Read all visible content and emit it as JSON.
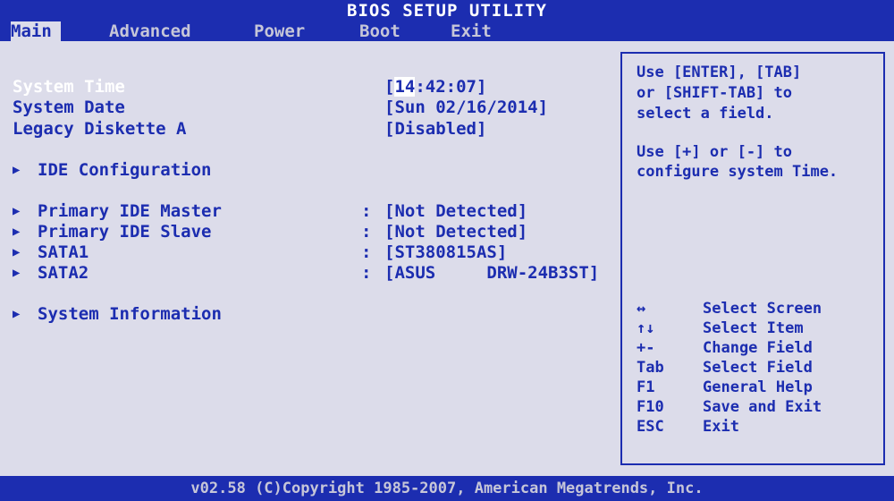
{
  "title": "BIOS SETUP UTILITY",
  "menu": {
    "items": [
      "Main",
      "Advanced",
      "Power",
      "Boot",
      "Exit"
    ]
  },
  "main": {
    "system_time": {
      "label": "System Time",
      "value_cursor": "14",
      "value_rest": ":42:07]",
      "value_open": "["
    },
    "system_date": {
      "label": "System Date",
      "value": "[Sun 02/16/2014]"
    },
    "legacy_diskette": {
      "label": "Legacy Diskette A",
      "value": "[Disabled]"
    },
    "ide_config": {
      "label": "IDE Configuration"
    },
    "primary_master": {
      "label": "Primary IDE Master",
      "colon": ":",
      "value": "[Not Detected]"
    },
    "primary_slave": {
      "label": "Primary IDE Slave",
      "colon": ":",
      "value": "[Not Detected]"
    },
    "sata1": {
      "label": "SATA1",
      "colon": ":",
      "value": "[ST380815AS]"
    },
    "sata2": {
      "label": "SATA2",
      "colon": ":",
      "value": "[ASUS     DRW-24B3ST]"
    },
    "system_info": {
      "label": "System Information"
    }
  },
  "help": {
    "line1": "Use [ENTER], [TAB]",
    "line2": "or [SHIFT-TAB] to",
    "line3": "select a field.",
    "line4": "Use [+] or [-] to",
    "line5": "configure system Time."
  },
  "keys": [
    {
      "key": "↔",
      "desc": "Select Screen"
    },
    {
      "key": "↑↓",
      "desc": "Select Item"
    },
    {
      "key": "+-",
      "desc": "Change Field"
    },
    {
      "key": "Tab",
      "desc": "Select Field"
    },
    {
      "key": "F1",
      "desc": "General Help"
    },
    {
      "key": "F10",
      "desc": "Save and Exit"
    },
    {
      "key": "ESC",
      "desc": "Exit"
    }
  ],
  "footer": "v02.58 (C)Copyright 1985-2007, American Megatrends, Inc."
}
